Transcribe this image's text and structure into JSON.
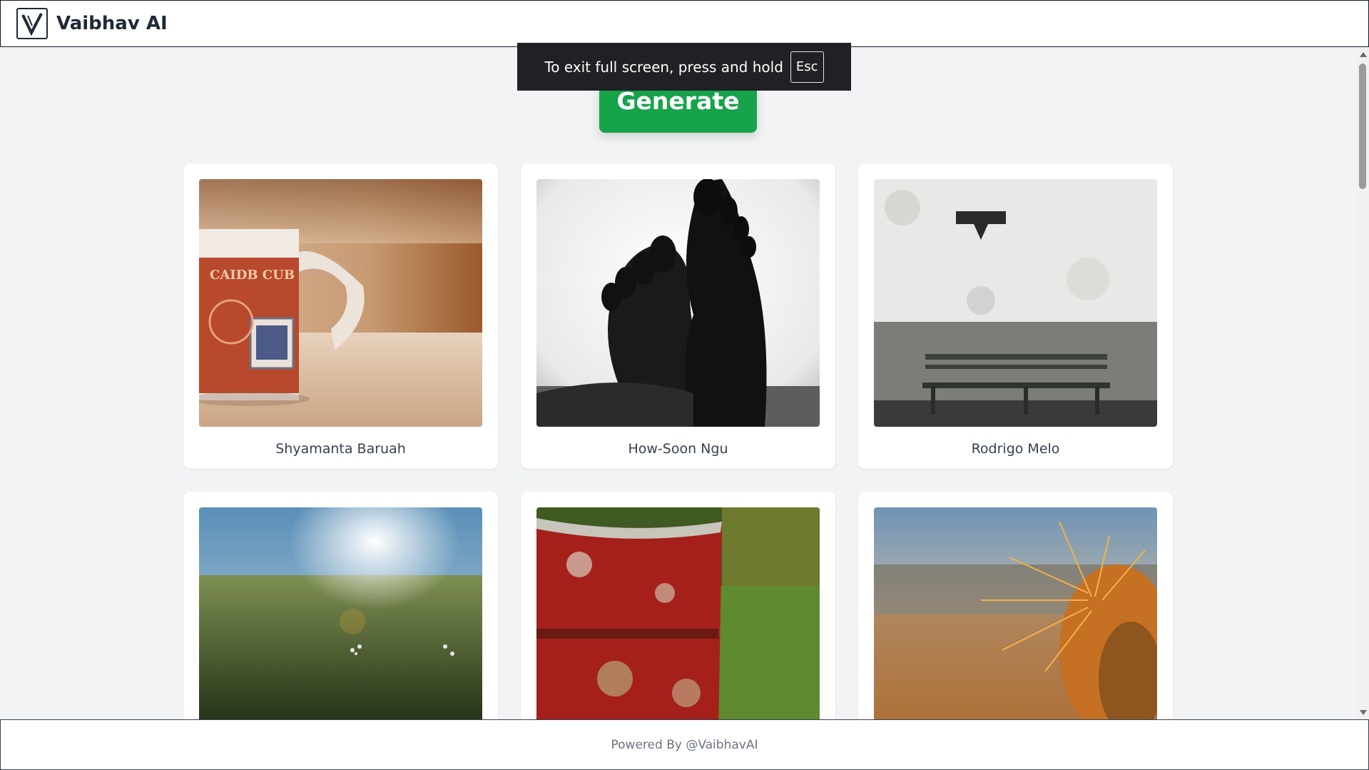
{
  "navbar": {
    "brand": "Vaibhav AI",
    "logo_icon": "v-logo-icon"
  },
  "fullscreen_toast": {
    "message": "To exit full screen, press and hold",
    "key": "Esc"
  },
  "generate_button": {
    "label": "Generate",
    "color": "#16a34a"
  },
  "gallery": {
    "cards": [
      {
        "caption": "Shyamanta Baruah",
        "photo": "coffee mug with stamp print on table"
      },
      {
        "caption": "How-Soon Ngu",
        "photo": "silhouette of crossed feet"
      },
      {
        "caption": "Rodrigo Melo",
        "photo": "bench against white wall"
      },
      {
        "caption": "",
        "photo": "sunlit grass field"
      },
      {
        "caption": "",
        "photo": "rusty red barrel in grass"
      },
      {
        "caption": "",
        "photo": "orange cactus spines close-up"
      }
    ]
  },
  "footer": {
    "text": "Powered By @VaibhavAI"
  }
}
